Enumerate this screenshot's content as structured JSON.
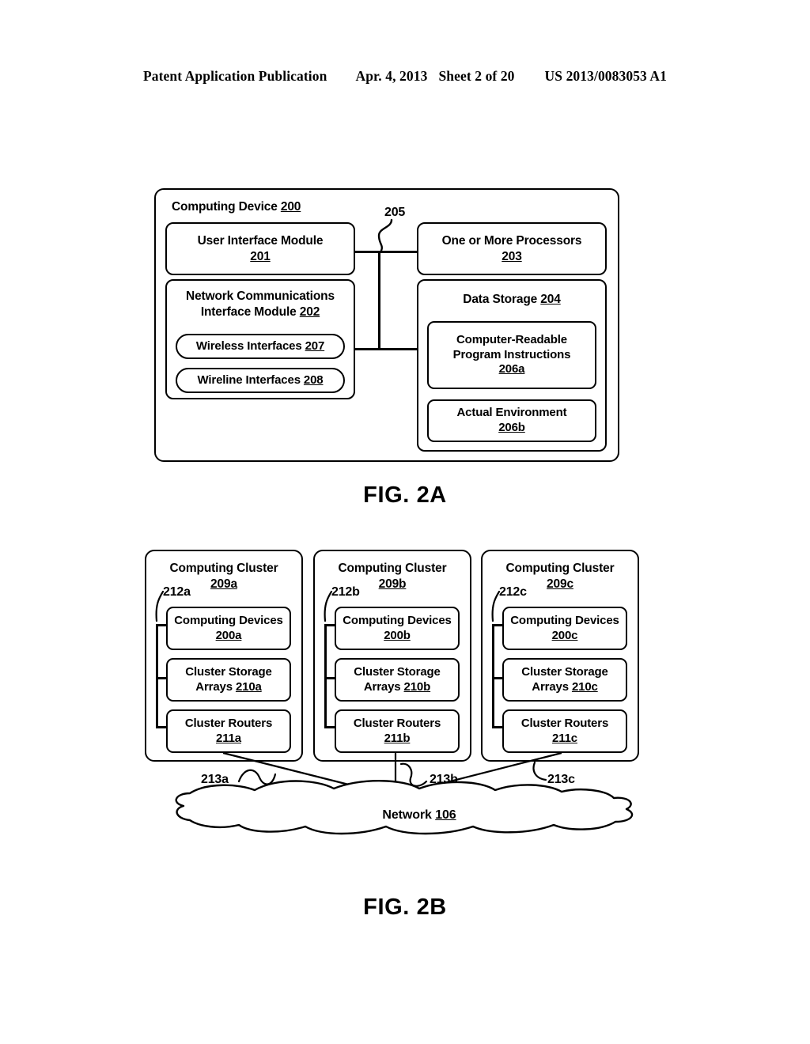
{
  "header": {
    "publication": "Patent Application Publication",
    "date": "Apr. 4, 2013",
    "sheet": "Sheet 2 of 20",
    "docnum": "US 2013/0083053 A1"
  },
  "fig2a": {
    "caption": "FIG. 2A",
    "outer": {
      "label": "Computing Device",
      "ref": "200"
    },
    "bus_ref": "205",
    "blocks": [
      {
        "name": "user-interface-module",
        "label": "User Interface Module",
        "ref": "201"
      },
      {
        "name": "network-communications-interface-module",
        "label": "Network Communications Interface Module",
        "ref": "202"
      },
      {
        "name": "wireless-interfaces",
        "label": "Wireless Interfaces",
        "ref": "207"
      },
      {
        "name": "wireline-interfaces",
        "label": "Wireline Interfaces",
        "ref": "208"
      },
      {
        "name": "one-or-more-processors",
        "label": "One or More Processors",
        "ref": "203"
      },
      {
        "name": "data-storage",
        "label": "Data Storage",
        "ref": "204"
      },
      {
        "name": "computer-readable-program-instructions",
        "label": "Computer-Readable Program Instructions",
        "ref": "206a"
      },
      {
        "name": "actual-environment",
        "label": "Actual Environment",
        "ref": "206b"
      }
    ]
  },
  "fig2b": {
    "caption": "FIG. 2B",
    "clusters": [
      {
        "title": "Computing Cluster",
        "ref": "209a",
        "bus_ref": "212a",
        "link_ref": "213a",
        "items": [
          {
            "label": "Computing Devices",
            "ref": "200a"
          },
          {
            "label": "Cluster Storage Arrays",
            "ref": "210a"
          },
          {
            "label": "Cluster Routers",
            "ref": "211a"
          }
        ]
      },
      {
        "title": "Computing Cluster",
        "ref": "209b",
        "bus_ref": "212b",
        "link_ref": "213b",
        "items": [
          {
            "label": "Computing Devices",
            "ref": "200b"
          },
          {
            "label": "Cluster Storage Arrays",
            "ref": "210b"
          },
          {
            "label": "Cluster Routers",
            "ref": "211b"
          }
        ]
      },
      {
        "title": "Computing Cluster",
        "ref": "209c",
        "bus_ref": "212c",
        "link_ref": "213c",
        "items": [
          {
            "label": "Computing Devices",
            "ref": "200c"
          },
          {
            "label": "Cluster Storage Arrays",
            "ref": "210c"
          },
          {
            "label": "Cluster Routers",
            "ref": "211c"
          }
        ]
      }
    ],
    "network": {
      "label": "Network",
      "ref": "106"
    }
  },
  "colors": {
    "ink": "#000000",
    "paper": "#ffffff"
  }
}
